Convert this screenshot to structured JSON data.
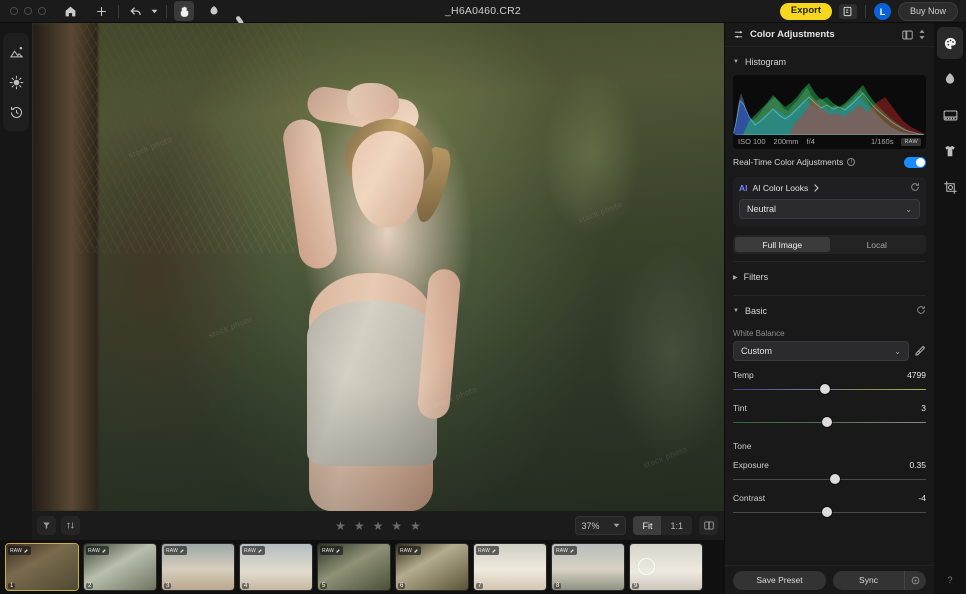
{
  "window": {
    "title": "_H6A0460.CR2",
    "traffic_icons": [
      "close-dot",
      "minimize-dot",
      "maximize-dot"
    ]
  },
  "toolbar": {
    "home_icon": "home-icon",
    "add_icon": "plus-icon",
    "undo_icon": "undo-icon",
    "undo_caret_icon": "chevron-down-icon",
    "hand_icon": "hand-icon",
    "dodge_icon": "dodge-tool-icon",
    "eraser_icon": "eraser-icon",
    "export_label": "Export",
    "export_color": "#f5d71f",
    "doc_icon": "export-document-icon",
    "avatar_label": "L",
    "avatar_color": "#0a63d6",
    "buy_now_label": "Buy Now"
  },
  "left_rail": {
    "items": [
      {
        "name": "library-icon",
        "label": "Library"
      },
      {
        "name": "presets-icon",
        "label": "Presets"
      },
      {
        "name": "history-icon",
        "label": "History"
      }
    ]
  },
  "right_rail": {
    "items": [
      {
        "name": "palette-icon",
        "label": "Color Adjustments",
        "active": true
      },
      {
        "name": "portrait-icon",
        "label": "Portrait",
        "active": false
      },
      {
        "name": "film-icon",
        "label": "Film",
        "active": false
      },
      {
        "name": "clothing-icon",
        "label": "Clothing",
        "active": false
      },
      {
        "name": "crop-icon",
        "label": "Crop",
        "active": false
      }
    ],
    "help_label": "?"
  },
  "strip_toolbar": {
    "filter_icon": "funnel-filter-icon",
    "sort_icon": "sort-icon",
    "rating_stars": 5,
    "rating_value": 0,
    "star_glyph": "★",
    "zoom_value": "37%",
    "zoom_caret_icon": "chevron-down-icon",
    "fit_label": "Fit",
    "one_to_one_label": "1:1",
    "compare_icon": "split-view-icon"
  },
  "filmstrip": {
    "badge_label": "RAW",
    "badge_edit_icon": "pencil-edit-icon",
    "thumbnails": [
      {
        "number": "1",
        "selected": true,
        "loading": false
      },
      {
        "number": "2",
        "selected": false,
        "loading": false
      },
      {
        "number": "3",
        "selected": false,
        "loading": false
      },
      {
        "number": "4",
        "selected": false,
        "loading": false
      },
      {
        "number": "5",
        "selected": false,
        "loading": false
      },
      {
        "number": "6",
        "selected": false,
        "loading": false
      },
      {
        "number": "7",
        "selected": false,
        "loading": false
      },
      {
        "number": "8",
        "selected": false,
        "loading": false
      },
      {
        "number": "9",
        "selected": false,
        "loading": true
      }
    ]
  },
  "panel": {
    "title": "Color Adjustments",
    "layout_icon": "panel-layout-icon",
    "stepper_icon": "up-down-chevron-icon",
    "histogram": {
      "label": "Histogram",
      "caret_icon": "caret-down-icon",
      "exif": {
        "iso": "ISO 100",
        "focal_length": "200mm",
        "aperture": "f/4",
        "shutter": "1/160s",
        "format_tag": "RAW"
      }
    },
    "realtime": {
      "label": "Real-Time Color Adjustments",
      "info_icon": "info-icon",
      "enabled": true,
      "toggle_color": "#1a8cff"
    },
    "ai_looks": {
      "logo_label": "AI",
      "title": "AI Color Looks",
      "chevron_icon": "chevron-right-icon",
      "reset_icon": "reset-icon",
      "selected_preset": "Neutral",
      "caret_icon": "chevron-down-icon"
    },
    "scope_tabs": [
      {
        "label": "Full Image",
        "active": true
      },
      {
        "label": "Local",
        "active": false
      }
    ],
    "sections": [
      {
        "label": "Filters",
        "expanded": false,
        "caret_icon": "caret-right-icon"
      },
      {
        "label": "Basic",
        "expanded": true,
        "caret_icon": "caret-down-icon",
        "reset_icon": "reset-icon"
      }
    ],
    "white_balance": {
      "label": "White Balance",
      "value": "Custom",
      "caret_icon": "chevron-down-icon",
      "eyedropper_icon": "eyedropper-icon"
    },
    "sliders": [
      {
        "name": "temp",
        "label": "Temp",
        "value": "4799",
        "pos_pct": 47,
        "kind": "temp"
      },
      {
        "name": "tint",
        "label": "Tint",
        "value": "3",
        "pos_pct": 48,
        "kind": "tint"
      }
    ],
    "tone_group_label": "Tone",
    "tone_sliders": [
      {
        "name": "exposure",
        "label": "Exposure",
        "value": "0.35",
        "pos_pct": 52,
        "kind": "plain"
      },
      {
        "name": "contrast",
        "label": "Contrast",
        "value": "-4",
        "pos_pct": 48,
        "kind": "plain"
      }
    ],
    "footer": {
      "save_preset_label": "Save Preset",
      "sync_label": "Sync",
      "sync_settings_icon": "sync-settings-icon"
    }
  },
  "canvas": {
    "watermarks": [
      "stock photo",
      "stock photo",
      "stock photo",
      "stock photo",
      "stock photo",
      "stock photo"
    ]
  }
}
